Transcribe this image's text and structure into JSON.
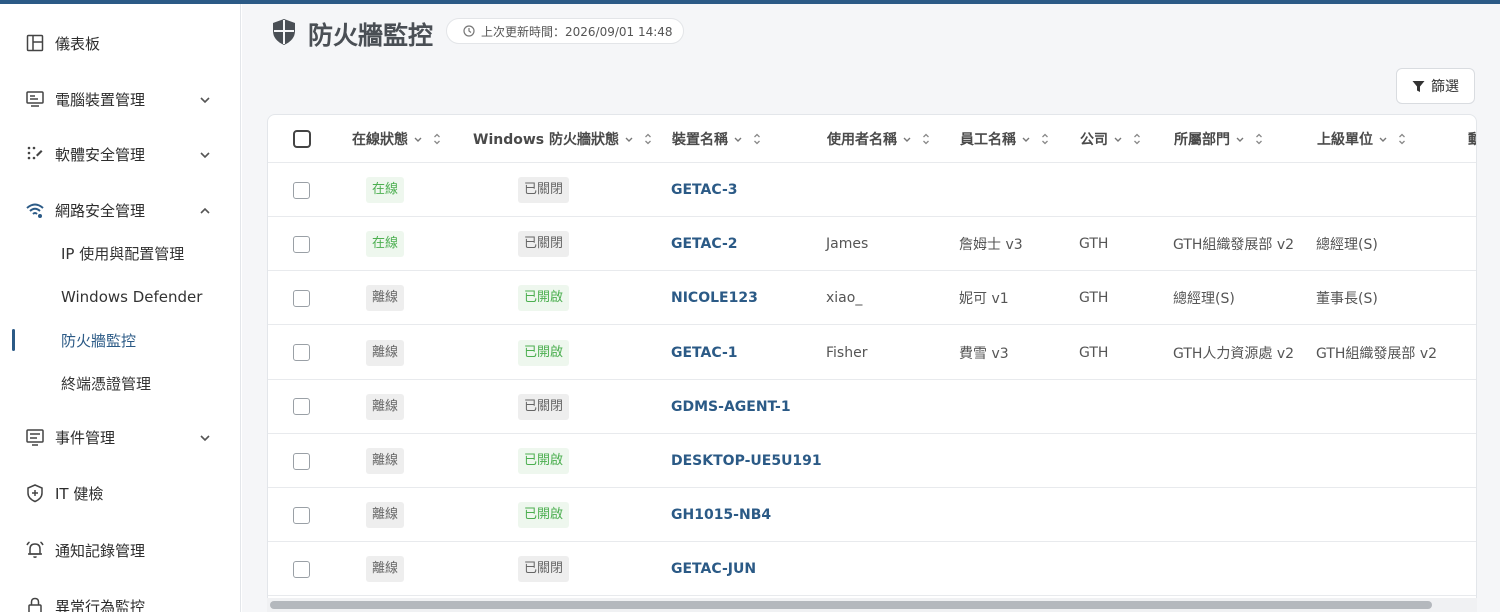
{
  "sidebar": {
    "items": [
      {
        "label": "儀表板",
        "icon": "dashboard-icon",
        "expandable": false
      },
      {
        "label": "電腦裝置管理",
        "icon": "device-icon",
        "expandable": true
      },
      {
        "label": "軟體安全管理",
        "icon": "software-icon",
        "expandable": true
      },
      {
        "label": "網路安全管理",
        "icon": "wifi-icon",
        "expandable": true,
        "expanded": true
      },
      {
        "label": "事件管理",
        "icon": "event-icon",
        "expandable": true
      },
      {
        "label": "IT 健檢",
        "icon": "shield-check-icon",
        "expandable": false
      },
      {
        "label": "通知記錄管理",
        "icon": "bell-icon",
        "expandable": false
      },
      {
        "label": "異常行為監控",
        "icon": "lock-icon",
        "expandable": false
      }
    ],
    "sub_items": [
      {
        "label": "IP 使用與配置管理"
      },
      {
        "label": "Windows Defender"
      },
      {
        "label": "防火牆監控",
        "active": true
      },
      {
        "label": "終端憑證管理"
      }
    ]
  },
  "header": {
    "title": "防火牆監控",
    "update_time": "上次更新時間：2026/09/01 14:48",
    "filter_label": "篩選"
  },
  "table": {
    "columns": [
      "在線狀態",
      "Windows 防火牆狀態",
      "裝置名稱",
      "使用者名稱",
      "員工名稱",
      "公司",
      "所屬部門",
      "上級單位",
      "動"
    ],
    "rows": [
      {
        "online": "在線",
        "online_status": "online",
        "firewall": "已關閉",
        "firewall_status": "closed",
        "device": "GETAC-3",
        "user": "",
        "employee": "",
        "company": "",
        "dept": "",
        "parent": ""
      },
      {
        "online": "在線",
        "online_status": "online",
        "firewall": "已關閉",
        "firewall_status": "closed",
        "device": "GETAC-2",
        "user": "James",
        "employee": "詹姆士 v3",
        "company": "GTH",
        "dept": "GTH組織發展部 v2",
        "parent": "總經理(S)"
      },
      {
        "online": "離線",
        "online_status": "offline",
        "firewall": "已開啟",
        "firewall_status": "open",
        "device": "NICOLE123",
        "user": "xiao_",
        "employee": "妮可 v1",
        "company": "GTH",
        "dept": "總經理(S)",
        "parent": "董事長(S)"
      },
      {
        "online": "離線",
        "online_status": "offline",
        "firewall": "已開啟",
        "firewall_status": "open",
        "device": "GETAC-1",
        "user": "Fisher",
        "employee": "費雪 v3",
        "company": "GTH",
        "dept": "GTH人力資源處 v2",
        "parent": "GTH組織發展部 v2"
      },
      {
        "online": "離線",
        "online_status": "offline",
        "firewall": "已關閉",
        "firewall_status": "closed",
        "device": "GDMS-AGENT-1",
        "user": "",
        "employee": "",
        "company": "",
        "dept": "",
        "parent": ""
      },
      {
        "online": "離線",
        "online_status": "offline",
        "firewall": "已開啟",
        "firewall_status": "open",
        "device": "DESKTOP-UE5U191",
        "user": "",
        "employee": "",
        "company": "",
        "dept": "",
        "parent": ""
      },
      {
        "online": "離線",
        "online_status": "offline",
        "firewall": "已開啟",
        "firewall_status": "open",
        "device": "GH1015-NB4",
        "user": "",
        "employee": "",
        "company": "",
        "dept": "",
        "parent": ""
      },
      {
        "online": "離線",
        "online_status": "offline",
        "firewall": "已關閉",
        "firewall_status": "closed",
        "device": "GETAC-JUN",
        "user": "",
        "employee": "",
        "company": "",
        "dept": "",
        "parent": ""
      }
    ]
  },
  "colors": {
    "accent": "#2b5a86",
    "online_green": "#4caf50",
    "badge_grey": "#eeeeee"
  }
}
